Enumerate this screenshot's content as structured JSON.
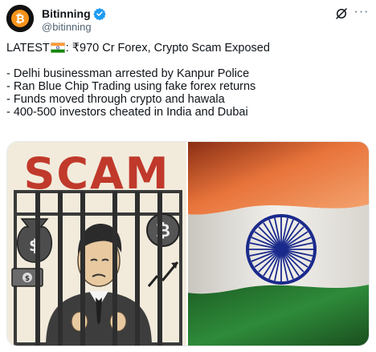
{
  "author": {
    "display_name": "Bitinning",
    "handle": "@bitinning",
    "verified_icon": "verified-badge-icon",
    "avatar_icon": "bitcoin-avatar-icon"
  },
  "actions": {
    "grok_icon": "grok-icon",
    "more_icon": "more-options-icon",
    "more_glyph": "···"
  },
  "tweet": {
    "headline_prefix": "LATEST",
    "headline_suffix": ": ₹970 Cr Forex, Crypto Scam Exposed",
    "flag_icon": "india-flag-icon",
    "bullets": [
      "- Delhi businessman arrested by Kanpur Police",
      "- Ran Blue Chip Trading using fake forex returns",
      "- Funds moved through crypto and hawala",
      "- 400-500 investors cheated in India and Dubai"
    ]
  },
  "media": {
    "left_image_text": "SCAM",
    "left_image_icons": [
      "money-bag-icon",
      "bitcoin-coin-icon",
      "cash-icon",
      "rising-chart-icon"
    ],
    "right_image": "india-flag-image"
  },
  "colors": {
    "handle_gray": "#536471",
    "verified_blue": "#1d9bf0",
    "scam_red": "#c0392b",
    "saffron": "#e8743b",
    "india_green": "#2e8b3a",
    "chakra_navy": "#1a2a8c"
  }
}
